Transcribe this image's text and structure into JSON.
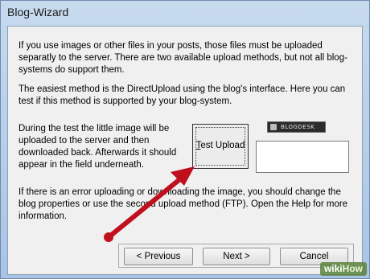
{
  "window": {
    "title": "Blog-Wizard"
  },
  "content": {
    "paragraph_1": "If you use images or other files in your posts, those files must be uploaded separatly to the server. There are two available upload methods, but not all blog-systems do support them.",
    "paragraph_2": "The easiest method is the DirectUpload using the blog's interface. Here you can test if this method is supported by your blog-system.",
    "paragraph_3": "During the test the little image will be uploaded to the server and then downloaded back. Afterwards it should appear in the field underneath.",
    "paragraph_4": "If there is an error uploading or downloading the image, you should change the blog properties or use the second upload method (FTP). Open the Help for more information."
  },
  "test_upload": {
    "label_prefix": "",
    "label_mnemonic": "T",
    "label_rest": "est Upload"
  },
  "logo": {
    "text": "BLOGDESK"
  },
  "buttons": {
    "previous": "< Previous",
    "next": "Next >",
    "cancel": "Cancel"
  },
  "watermark": {
    "prefix": "wiki",
    "suffix": "How"
  },
  "colors": {
    "arrow": "#c0101e",
    "titlebar": "#b9d1ea"
  }
}
